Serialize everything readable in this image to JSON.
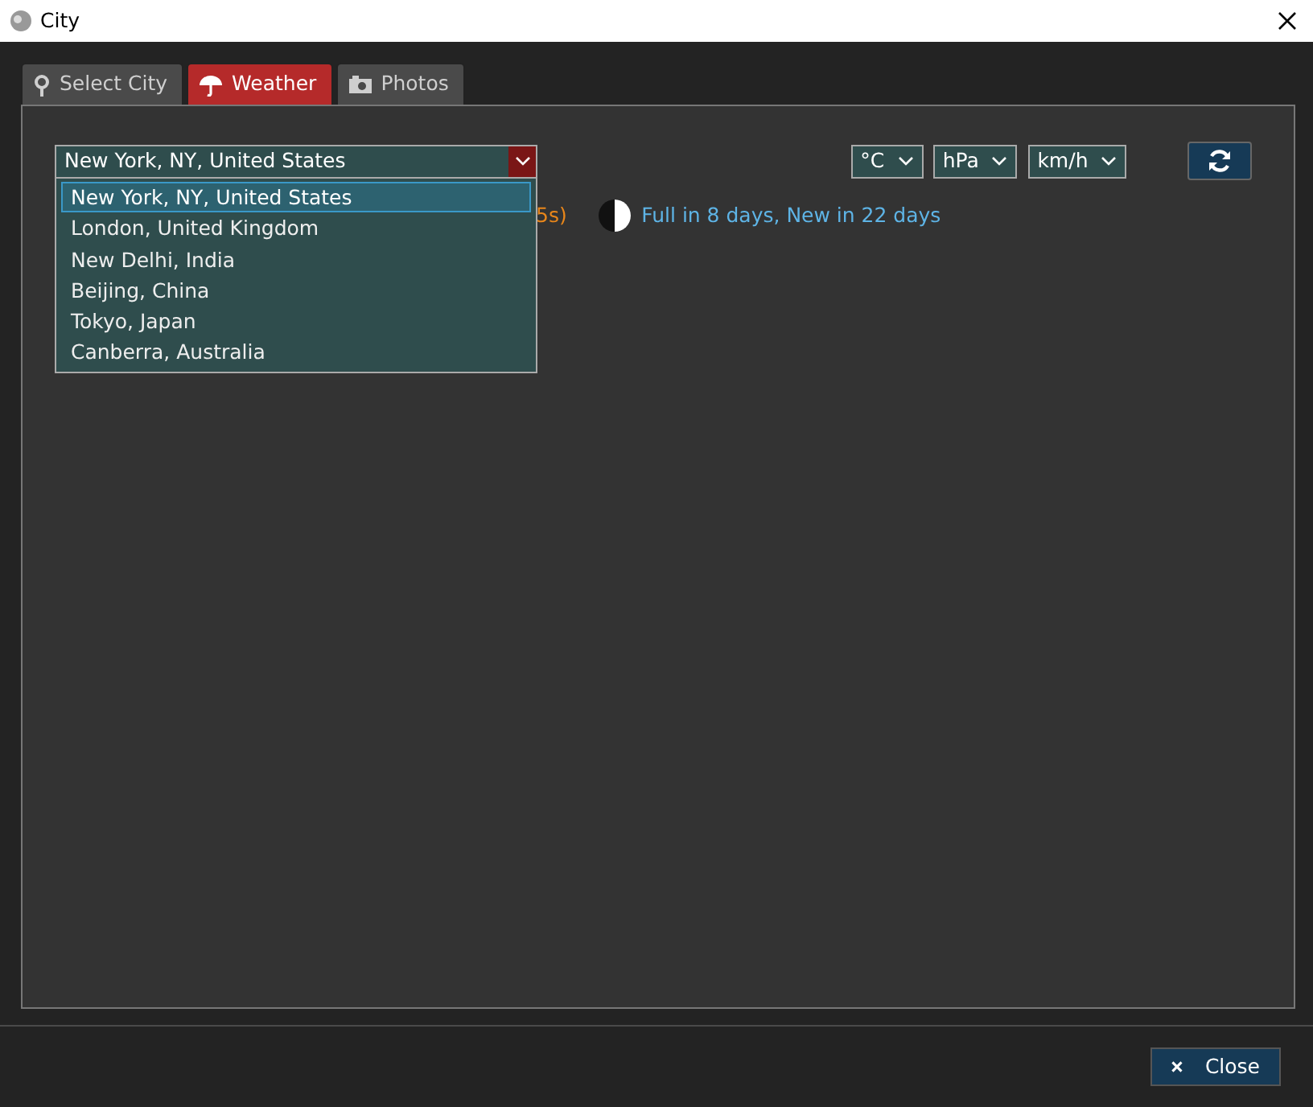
{
  "window": {
    "title": "City"
  },
  "tabs": [
    {
      "label": "Select City",
      "selected": false
    },
    {
      "label": "Weather",
      "selected": true
    },
    {
      "label": "Photos",
      "selected": false
    }
  ],
  "city_select": {
    "value": "New York, NY, United States",
    "expanded": true,
    "options": [
      {
        "label": "New York, NY, United States",
        "selected": true
      },
      {
        "label": "London, United Kingdom",
        "selected": false
      },
      {
        "label": "New Delhi, India",
        "selected": false
      },
      {
        "label": "Beijing, China",
        "selected": false
      },
      {
        "label": "Tokyo, Japan",
        "selected": false
      },
      {
        "label": "Canberra, Australia",
        "selected": false
      }
    ]
  },
  "unit_selects": [
    {
      "value": "°C"
    },
    {
      "value": "hPa"
    },
    {
      "value": "km/h"
    }
  ],
  "status_fragment": "5s)",
  "moon_phase": "Full in 8 days, New in 22 days",
  "close_button": {
    "label": "Close"
  }
}
